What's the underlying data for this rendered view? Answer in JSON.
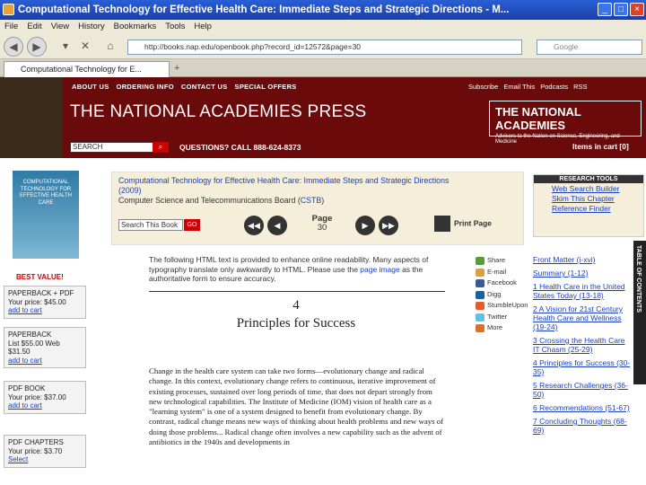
{
  "window": {
    "title": "Computational Technology for Effective Health Care: Immediate Steps and Strategic Directions - M..."
  },
  "menu": [
    "File",
    "Edit",
    "View",
    "History",
    "Bookmarks",
    "Tools",
    "Help"
  ],
  "browser": {
    "url": "http://books.nap.edu/openbook.php?record_id=12572&page=30",
    "search_placeholder": "Google",
    "tab_label": "Computational Technology for E..."
  },
  "site": {
    "top_nav": [
      "ABOUT US",
      "ORDERING INFO",
      "CONTACT US",
      "SPECIAL OFFERS"
    ],
    "util_nav": [
      "Subscribe",
      "Email This",
      "Podcasts",
      "RSS"
    ],
    "logo": "THE NATIONAL ACADEMIES PRESS",
    "na_title": "THE NATIONAL ACADEMIES",
    "na_tagline": "Advisers to the Nation on Science, Engineering, and Medicine",
    "search_value": "SEARCH",
    "questions": "QUESTIONS? CALL 888-624-8373",
    "cart": "Items in cart [0]"
  },
  "book": {
    "cover_text": "COMPUTATIONAL TECHNOLOGY FOR EFFECTIVE HEALTH CARE",
    "title": "Computational Technology for Effective Health Care: Immediate Steps and Strategic Directions",
    "year": "(2009)",
    "board_prefix": "Computer Science and Telecommunications Board (",
    "board_abbr": "CSTB",
    "board_suffix": ")",
    "search_this_book": "Search This Book",
    "go": "GO",
    "page_label": "Page",
    "page_number": "30",
    "print_label": "Print Page"
  },
  "purchase": {
    "best_value": "BEST VALUE!",
    "options": [
      {
        "title": "PAPERBACK + PDF",
        "price": "Your price: $45.00",
        "link": "add to cart"
      },
      {
        "title": "PAPERBACK",
        "price": "List $55.00 Web $31.50",
        "link": "add to cart"
      },
      {
        "title": "PDF BOOK",
        "price": "Your price: $37.00",
        "link": "add to cart"
      },
      {
        "title": "PDF CHAPTERS",
        "price": "Your price: $3.70",
        "link": "Select"
      }
    ]
  },
  "research_tools": {
    "head": "RESEARCH TOOLS",
    "links": [
      "Web Search Builder",
      "Skim This Chapter",
      "Reference Finder"
    ]
  },
  "share": [
    "Share",
    "E-mail",
    "Facebook",
    "Digg",
    "StumbleUpon",
    "Twitter",
    "More"
  ],
  "content": {
    "notice_pre": "The following HTML text is provided to enhance online readability. Many aspects of typography translate only awkwardly to HTML. Please use the ",
    "notice_link": "page image",
    "notice_post": " as the authoritative form to ensure accuracy.",
    "chapter_number": "4",
    "chapter_title": "Principles for Success",
    "body": "Change in the health care system can take two forms—evolutionary change and radical change. In this context, evolutionary change refers to continuous, iterative improvement of existing processes, sustained over long periods of time, that does not depart strongly from new technological capabilities. The Institute of Medicine (IOM) vision of health care as a \"learning system\" is one of a system designed to benefit from evolutionary change. By contrast, radical change means new ways of thinking about health problems and new ways of doing those problems... Radical change often involves a new capability such as the advent of antibiotics in the 1940s and developments in"
  },
  "toc": {
    "label": "TABLE OF CONTENTS",
    "items": [
      "Front Matter (i-xvi)",
      "Summary (1-12)",
      "1 Health Care in the United States Today (13-18)",
      "2 A Vision for 21st Century Health Care and Wellness (19-24)",
      "3 Crossing the Health Care IT Chasm (25-29)",
      "4 Principles for Success (30-35)",
      "5 Research Challenges (36-50)",
      "6 Recommendations (51-67)",
      "7 Concluding Thoughts (68-69)"
    ]
  }
}
